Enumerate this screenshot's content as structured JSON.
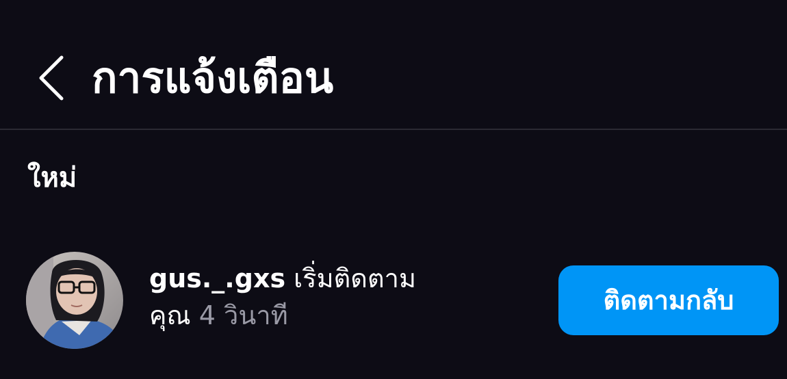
{
  "header": {
    "back_icon": "chevron-left-icon",
    "title": "การแจ้งเตือน"
  },
  "sections": [
    {
      "label": "ใหม่",
      "items": [
        {
          "avatar_icon": "user-avatar",
          "username": "gus._.gxs",
          "action": "เริ่มติดตาม",
          "target": "คุณ",
          "time": "4 วินาที",
          "button_label": "ติดตามกลับ",
          "button_color": "#0095f6"
        }
      ]
    }
  ],
  "colors": {
    "background": "#0d0c15",
    "text_primary": "#ffffff",
    "text_secondary": "#9a9aa6",
    "divider": "#2b2a33",
    "accent": "#0095f6"
  }
}
